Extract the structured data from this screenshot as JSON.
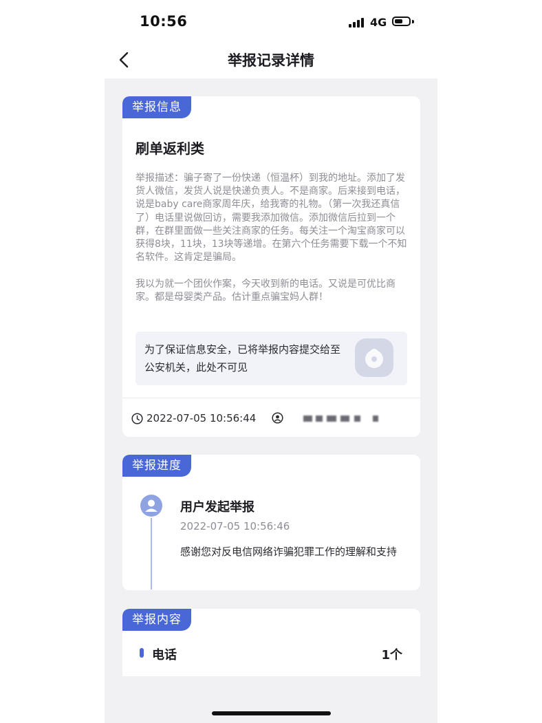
{
  "status_bar": {
    "time": "10:56",
    "network": "4G"
  },
  "nav": {
    "title": "举报记录详情",
    "back_icon": "chevron-left-icon"
  },
  "report_info": {
    "tag": "举报信息",
    "category": "刷单返利类",
    "description": "举报描述：骗子寄了一份快递（恒温杯）到我的地址。添加了发货人微信，发货人说是快递负责人。不是商家。后来接到电话，说是baby care商家周年庆，给我寄的礼物。（第一次我还真信了）电话里说做回访，需要我添加微信。添加微信后拉到一个群，在群里面做一些关注商家的任务。每关注一个淘宝商家可以获得8块，11块，13块等递增。在第六个任务需要下载一个不知名软件。这肯定是骗局。\n\n我以为就一个团伙作案，今天收到新的电话。又说是可优比商家。都是母婴类产品。估计重点骗宝妈人群！",
    "notice": "为了保证信息安全，已将举报内容提交给至公安机关，此处不可见",
    "lock_icon": "lock-icon",
    "time": "2022-07-05 10:56:44",
    "user_icon": "user-icon"
  },
  "progress": {
    "tag": "举报进度",
    "items": [
      {
        "title": "用户发起举报",
        "time": "2022-07-05 10:56:46",
        "text": "感谢您对反电信网络诈骗犯罪工作的理解和支持"
      }
    ]
  },
  "content": {
    "tag": "举报内容",
    "items": [
      {
        "label": "电话",
        "count": "1个"
      }
    ]
  },
  "colors": {
    "accent": "#4a67d8",
    "background": "#f1f1f4",
    "card": "#ffffff",
    "muted_text": "#8d8d96"
  }
}
